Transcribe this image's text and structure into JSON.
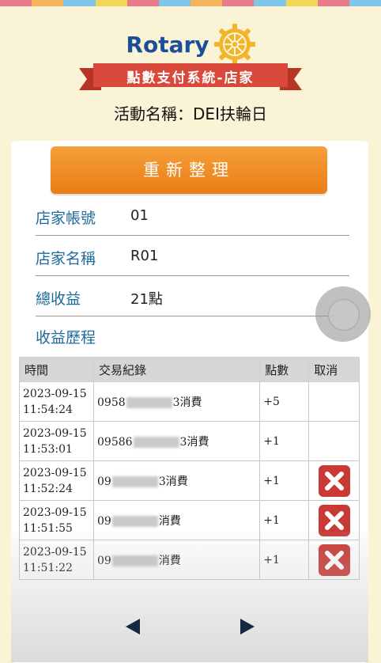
{
  "header": {
    "logo_text": "Rotary",
    "subtitle": "點數支付系統-店家",
    "event": "活動名稱：DEI扶輪日",
    "stripe_colors": [
      "#e97a8a",
      "#f3b45a",
      "#7fc6e8",
      "#f0d75a",
      "#e97a8a",
      "#7fc6e8",
      "#f3b45a",
      "#e97a8a",
      "#7fc6e8",
      "#f0d75a",
      "#e97a8a",
      "#7fc6e8"
    ]
  },
  "refresh_button": "重新整理",
  "info": {
    "account_label": "店家帳號",
    "account_value": "01",
    "name_label": "店家名稱",
    "name_value": "R01",
    "total_label": "總收益",
    "total_value": "21點",
    "history_label": "收益歷程"
  },
  "table": {
    "headers": [
      "時間",
      "交易紀錄",
      "點數",
      "取消"
    ],
    "rows": [
      {
        "date": "2023-09-15",
        "time": "11:54:24",
        "rec_prefix": "0958",
        "rec_suffix": "3消費",
        "points": "+5",
        "cancel": false
      },
      {
        "date": "2023-09-15",
        "time": "11:53:01",
        "rec_prefix": "09586",
        "rec_suffix": "3消費",
        "points": "+1",
        "cancel": false
      },
      {
        "date": "2023-09-15",
        "time": "11:52:24",
        "rec_prefix": "09",
        "rec_suffix": "3消費",
        "points": "+1",
        "cancel": true
      },
      {
        "date": "2023-09-15",
        "time": "11:51:55",
        "rec_prefix": "09",
        "rec_suffix": "消費",
        "points": "+1",
        "cancel": true
      },
      {
        "date": "2023-09-15",
        "time": "11:51:22",
        "rec_prefix": "09",
        "rec_suffix": "消費",
        "points": "+1",
        "cancel": true
      }
    ]
  },
  "colors": {
    "accent_orange": "#ee8420",
    "ribbon_red": "#d9493b",
    "label_blue": "#1e6b9c",
    "cancel_red": "#c93a36"
  }
}
